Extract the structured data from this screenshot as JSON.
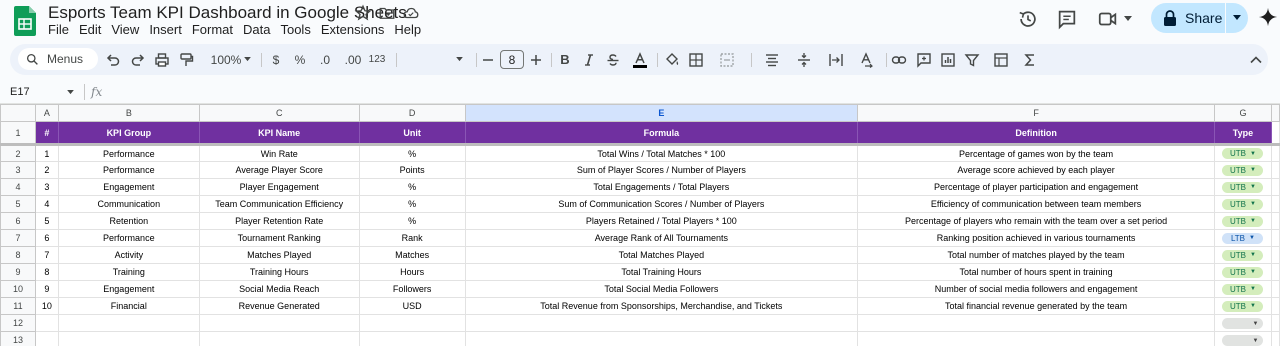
{
  "app": {
    "title": "Esports Team KPI Dashboard in Google Sheets",
    "menu": [
      "File",
      "Edit",
      "View",
      "Insert",
      "Format",
      "Data",
      "Tools",
      "Extensions",
      "Help"
    ],
    "share_label": "Share"
  },
  "toolbar": {
    "menus_label": "Menus",
    "zoom": "100%",
    "currency": "$",
    "percent": "%",
    "dec_decrease": ".0",
    "dec_increase": ".00",
    "number_format": "123",
    "font_size": "8",
    "bold": "B"
  },
  "formula_bar": {
    "cell_ref": "E17",
    "fx": "fx",
    "value": ""
  },
  "columns": [
    "A",
    "B",
    "C",
    "D",
    "E",
    "F",
    "G"
  ],
  "selected_column": "E",
  "header_row": [
    "#",
    "KPI Group",
    "KPI Name",
    "Unit",
    "Formula",
    "Definition",
    "Type"
  ],
  "rows": [
    {
      "n": "1",
      "group": "Performance",
      "name": "Win Rate",
      "unit": "%",
      "formula": "Total Wins / Total Matches * 100",
      "definition": "Percentage of games won by the team",
      "type": "UTB"
    },
    {
      "n": "2",
      "group": "Performance",
      "name": "Average Player Score",
      "unit": "Points",
      "formula": "Sum of Player Scores / Number of Players",
      "definition": "Average score achieved by each player",
      "type": "UTB"
    },
    {
      "n": "3",
      "group": "Engagement",
      "name": "Player Engagement",
      "unit": "%",
      "formula": "Total Engagements / Total Players",
      "definition": "Percentage of player participation and engagement",
      "type": "UTB"
    },
    {
      "n": "4",
      "group": "Communication",
      "name": "Team Communication Efficiency",
      "unit": "%",
      "formula": "Sum of Communication Scores / Number of Players",
      "definition": "Efficiency of communication between team members",
      "type": "UTB"
    },
    {
      "n": "5",
      "group": "Retention",
      "name": "Player Retention Rate",
      "unit": "%",
      "formula": "Players Retained / Total Players * 100",
      "definition": "Percentage of players who remain with the team over a set period",
      "type": "UTB"
    },
    {
      "n": "6",
      "group": "Performance",
      "name": "Tournament Ranking",
      "unit": "Rank",
      "formula": "Average Rank of All Tournaments",
      "definition": "Ranking position achieved in various tournaments",
      "type": "LTB"
    },
    {
      "n": "7",
      "group": "Activity",
      "name": "Matches Played",
      "unit": "Matches",
      "formula": "Total Matches Played",
      "definition": "Total number of matches played by the team",
      "type": "UTB"
    },
    {
      "n": "8",
      "group": "Training",
      "name": "Training Hours",
      "unit": "Hours",
      "formula": "Total Training Hours",
      "definition": "Total number of hours spent in training",
      "type": "UTB"
    },
    {
      "n": "9",
      "group": "Engagement",
      "name": "Social Media Reach",
      "unit": "Followers",
      "formula": "Total Social Media Followers",
      "definition": "Number of social media followers and engagement",
      "type": "UTB"
    },
    {
      "n": "10",
      "group": "Financial",
      "name": "Revenue Generated",
      "unit": "USD",
      "formula": "Total Revenue from Sponsorships, Merchandise, and Tickets",
      "definition": "Total financial revenue generated by the team",
      "type": "UTB"
    }
  ],
  "row_numbers": [
    "1",
    "2",
    "3",
    "4",
    "5",
    "6",
    "7",
    "8",
    "9",
    "10",
    "11",
    "12",
    "13"
  ],
  "colors": {
    "header_bg": "#7030a0",
    "utb_chip": "#d4edbc",
    "ltb_chip": "#d0e2f8",
    "share_bg": "#c2e7ff"
  }
}
